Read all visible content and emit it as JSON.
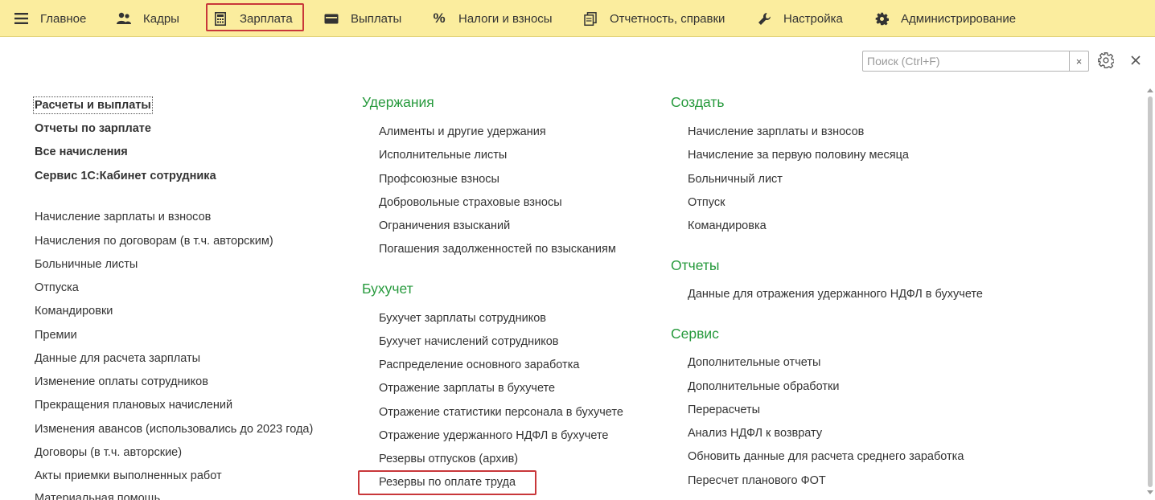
{
  "nav": {
    "items": [
      {
        "label": "Главное",
        "icon": "hamburger-icon"
      },
      {
        "label": "Кадры",
        "icon": "people-icon"
      },
      {
        "label": "Зарплата",
        "icon": "calculator-icon"
      },
      {
        "label": "Выплаты",
        "icon": "wallet-icon"
      },
      {
        "label": "Налоги и взносы",
        "icon": "percent-icon"
      },
      {
        "label": "Отчетность, справки",
        "icon": "documents-icon"
      },
      {
        "label": "Настройка",
        "icon": "wrench-icon"
      },
      {
        "label": "Администрирование",
        "icon": "gear-icon"
      }
    ],
    "highlighted": "Зарплата"
  },
  "search": {
    "placeholder": "Поиск (Ctrl+F)",
    "value": "",
    "clear_label": "×"
  },
  "left_column": {
    "bold_links": [
      "Расчеты и выплаты",
      "Отчеты по зарплате",
      "Все начисления",
      "Сервис 1С:Кабинет сотрудника"
    ],
    "links": [
      "Начисление зарплаты и взносов",
      "Начисления по договорам (в т.ч. авторским)",
      "Больничные листы",
      "Отпуска",
      "Командировки",
      "Премии",
      "Данные для расчета зарплаты",
      "Изменение оплаты сотрудников",
      "Прекращения плановых начислений",
      "Изменения авансов (использовались до 2023 года)",
      "Договоры (в т.ч. авторские)",
      "Акты приемки выполненных работ",
      "Материальная помощь"
    ]
  },
  "middle_column": {
    "sections": [
      {
        "title": "Удержания",
        "links": [
          "Алименты и другие удержания",
          "Исполнительные листы",
          "Профсоюзные взносы",
          "Добровольные страховые взносы",
          "Ограничения взысканий",
          "Погашения задолженностей по взысканиям"
        ]
      },
      {
        "title": "Бухучет",
        "links": [
          "Бухучет зарплаты сотрудников",
          "Бухучет начислений сотрудников",
          "Распределение основного заработка",
          "Отражение зарплаты в бухучете",
          "Отражение статистики персонала в бухучете",
          "Отражение удержанного НДФЛ в бухучете",
          "Резервы отпусков (архив)",
          "Резервы по оплате труда"
        ]
      }
    ],
    "highlighted": "Резервы по оплате труда"
  },
  "right_column": {
    "sections": [
      {
        "title": "Создать",
        "links": [
          "Начисление зарплаты и взносов",
          "Начисление за первую половину месяца",
          "Больничный лист",
          "Отпуск",
          "Командировка"
        ]
      },
      {
        "title": "Отчеты",
        "links": [
          "Данные для отражения удержанного НДФЛ в бухучете"
        ]
      },
      {
        "title": "Сервис",
        "links": [
          "Дополнительные отчеты",
          "Дополнительные обработки",
          "Перерасчеты",
          "Анализ НДФЛ к возврату",
          "Обновить данные для расчета среднего заработка",
          "Пересчет планового ФОТ"
        ]
      }
    ]
  },
  "colors": {
    "nav_bg": "#fbed9e",
    "section_title": "#279a3d",
    "highlight": "#c8373a",
    "text": "#333333"
  }
}
